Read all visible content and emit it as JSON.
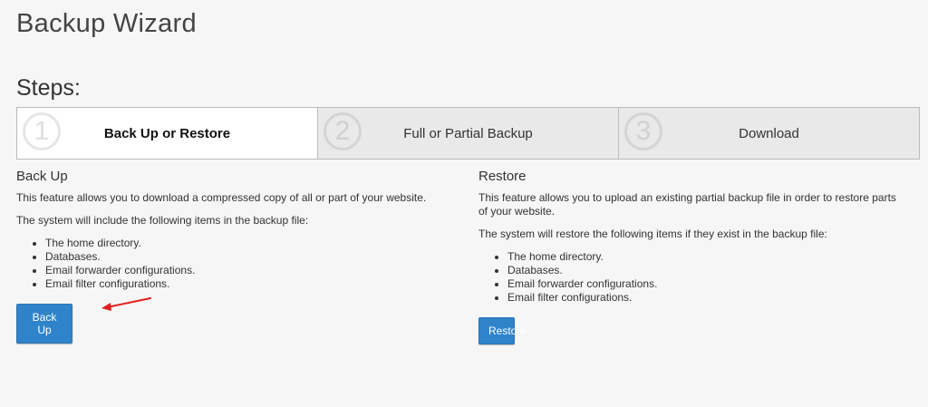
{
  "header": {
    "title": "Backup Wizard"
  },
  "steps": {
    "heading": "Steps:",
    "items": [
      {
        "number": "1",
        "label": "Back Up or Restore",
        "active": true
      },
      {
        "number": "2",
        "label": "Full or Partial Backup",
        "active": false
      },
      {
        "number": "3",
        "label": "Download",
        "active": false
      }
    ]
  },
  "backup": {
    "heading": "Back Up",
    "description": "This feature allows you to download a compressed copy of all or part of your website.",
    "list_intro": "The system will include the following items in the backup file:",
    "items": [
      "The home directory.",
      "Databases.",
      "Email forwarder configurations.",
      "Email filter configurations."
    ],
    "button_label": "Back Up"
  },
  "restore": {
    "heading": "Restore",
    "description": "This feature allows you to upload an existing partial backup file in order to restore parts of your website.",
    "list_intro": "The system will restore the following items if they exist in the backup file:",
    "items": [
      "The home directory.",
      "Databases.",
      "Email forwarder configurations.",
      "Email filter configurations."
    ],
    "button_label": "Restore"
  },
  "colors": {
    "button": "#2f83c9",
    "annotation_arrow": "#e02020",
    "active_step_bg": "#ffffff",
    "inactive_step_bg": "#e9e9e9"
  }
}
